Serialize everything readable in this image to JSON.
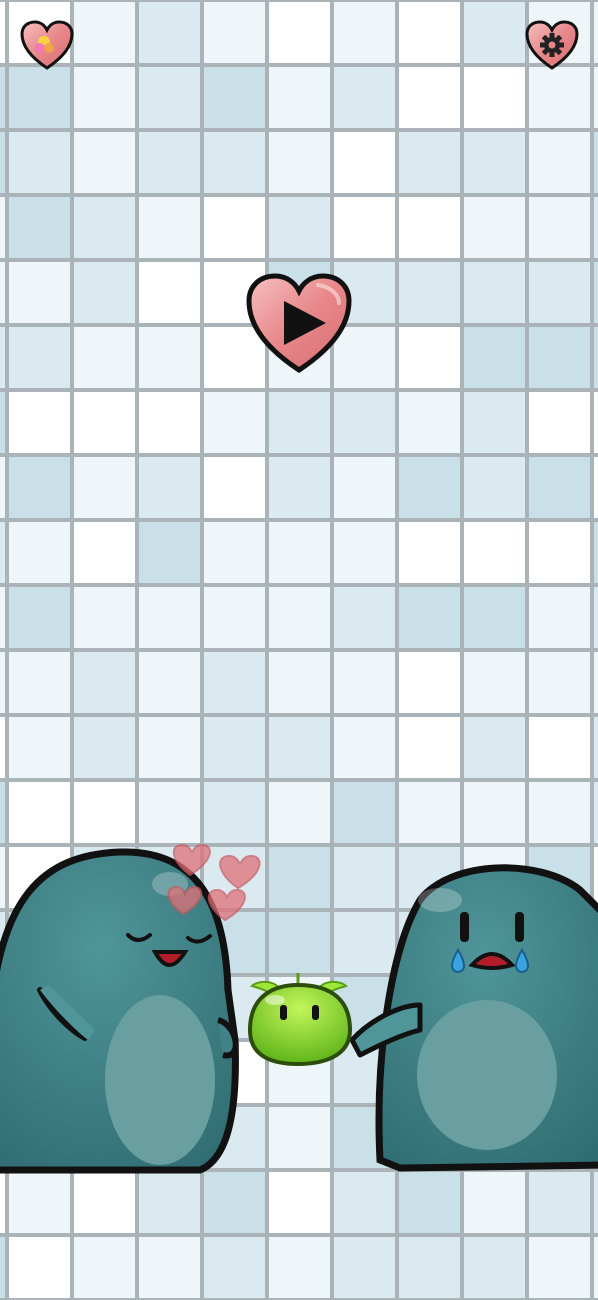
{
  "app": {
    "screen": "home"
  },
  "colors": {
    "tile_light": "#eef6f9",
    "tile_mid": "#dbeaf0",
    "tile_dark": "#c9e0e8",
    "tile_white": "#ffffff",
    "grout": "#aab4b8",
    "heart_fill": "#e8878a",
    "heart_light": "#f3b3b3",
    "outline": "#1a1a1a",
    "blob_body": "#3f8388",
    "blob_belly": "#6a9fa2",
    "blob_shadow": "#2f6a6e",
    "slime_green": "#7fd321",
    "slime_light": "#b6f04a"
  },
  "buttons": {
    "top_left": {
      "icon": "heart-gallery-icon"
    },
    "top_right": {
      "icon": "heart-settings-icon"
    },
    "play": {
      "icon": "heart-play-icon"
    }
  },
  "characters": [
    {
      "name": "happy-blob",
      "mood": "happy"
    },
    {
      "name": "baby-slime",
      "mood": "neutral"
    },
    {
      "name": "crying-blob",
      "mood": "sad"
    }
  ],
  "floating_hearts": 4
}
